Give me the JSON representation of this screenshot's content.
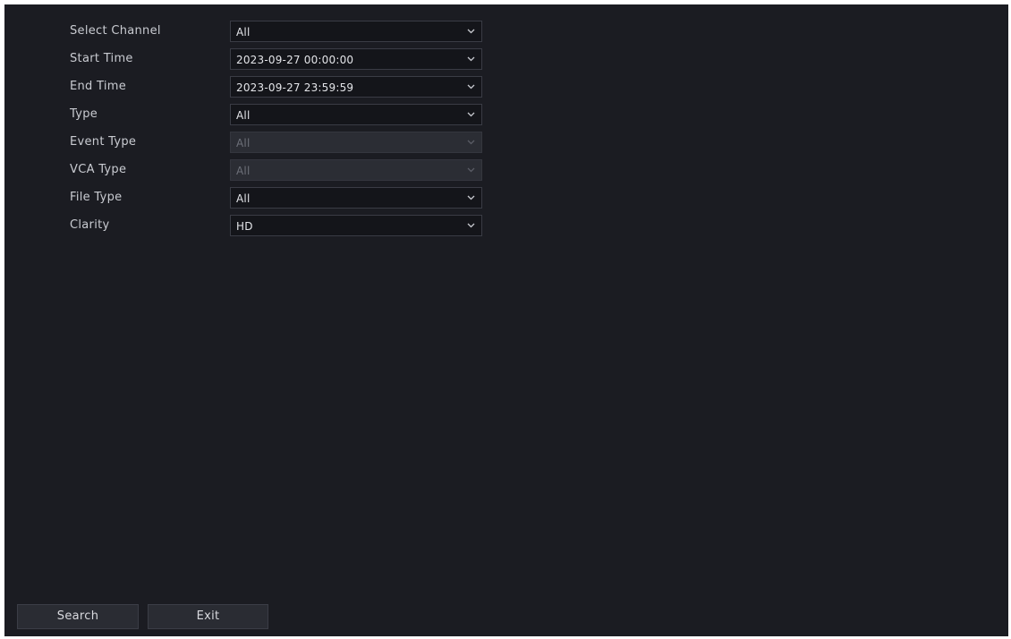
{
  "form": {
    "fields": [
      {
        "label": "Select Channel",
        "value": "All",
        "disabled": false
      },
      {
        "label": "Start Time",
        "value": "2023-09-27 00:00:00",
        "disabled": false
      },
      {
        "label": "End Time",
        "value": "2023-09-27 23:59:59",
        "disabled": false
      },
      {
        "label": "Type",
        "value": "All",
        "disabled": false
      },
      {
        "label": "Event Type",
        "value": "All",
        "disabled": true
      },
      {
        "label": "VCA Type",
        "value": "All",
        "disabled": true
      },
      {
        "label": "File Type",
        "value": "All",
        "disabled": false
      },
      {
        "label": "Clarity",
        "value": "HD",
        "disabled": false
      }
    ]
  },
  "footer": {
    "search_label": "Search",
    "exit_label": "Exit"
  },
  "icons": {
    "dropdown": "chevron-down-icon"
  },
  "colors": {
    "background": "#1b1c22",
    "field_bg": "#14151a",
    "disabled_field_bg": "#2b2d34",
    "button_bg": "#2a2c33"
  }
}
